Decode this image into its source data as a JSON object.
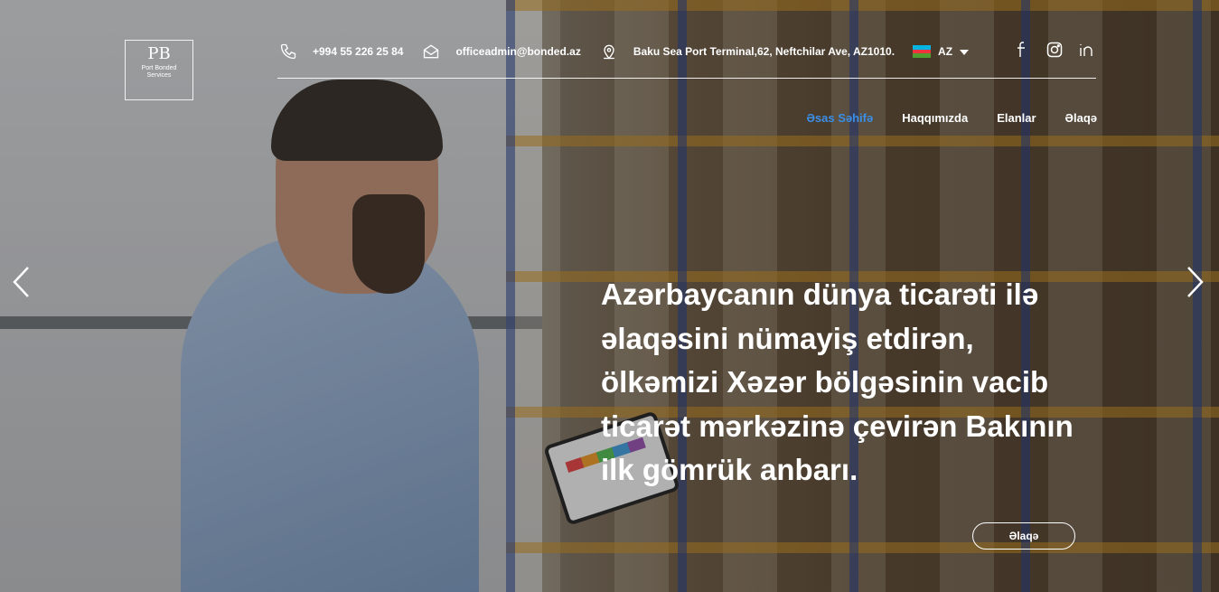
{
  "logo": {
    "mark": "PB",
    "line1": "Port Bonded",
    "line2": "Services"
  },
  "contact": {
    "phone": "+994 55 226 25 84",
    "email": "officeadmin@bonded.az",
    "address": "Baku Sea Port Terminal,62, Neftchilar Ave, AZ1010.",
    "phone_icon": "phone-icon",
    "email_icon": "envelope-icon",
    "address_icon": "location-pin-icon"
  },
  "language": {
    "selected": "AZ",
    "flag": "azerbaijan-flag",
    "flag_colors": [
      "#00b5e2",
      "#ef3340",
      "#509e2f"
    ]
  },
  "socials": [
    {
      "name": "facebook-icon",
      "glyph": "f"
    },
    {
      "name": "instagram-icon",
      "glyph": "◎"
    },
    {
      "name": "linkedin-icon",
      "glyph": "in"
    }
  ],
  "nav": {
    "items": [
      {
        "label": "Əsas Səhifə",
        "active": true
      },
      {
        "label": "Haqqımızda",
        "active": false
      },
      {
        "label": "Elanlar",
        "active": false
      },
      {
        "label": "Əlaqə",
        "active": false
      }
    ],
    "active_color": "#3a8ee6"
  },
  "hero": {
    "headline_lines": [
      "Azərbaycanın dünya ticarəti ilə",
      "əlaqəsini nümayiş etdirən,",
      "ölkəmizi Xəzər bölgəsinin vacib",
      "ticarət mərkəzinə çevirən Bakının",
      "ilk gömrük anbarı."
    ],
    "cta_label": "Əlaqə"
  },
  "slider": {
    "prev_icon": "chevron-left-icon",
    "next_icon": "chevron-right-icon"
  }
}
